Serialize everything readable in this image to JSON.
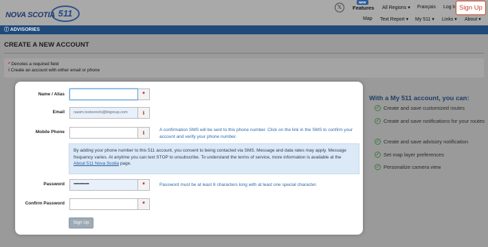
{
  "header": {
    "logo_text": "NOVA SCOTIA",
    "logo_badge": "511",
    "x_icon": "x-social-icon",
    "new_badge": "NEW",
    "features": "Features",
    "top_nav": [
      "All Regions ▾",
      "Français",
      "Log In"
    ],
    "signup_label": "Sign Up",
    "sub_nav": [
      "Map",
      "Text Report ▾",
      "My 511 ▾",
      "Links ▾",
      "About ▾"
    ]
  },
  "advisories": {
    "icon": "info-circle-icon",
    "label": "ADVISORIES"
  },
  "page": {
    "title": "CREATE A NEW ACCOUNT",
    "note_required": "Denotes a required field",
    "note_required_mark": "*",
    "note_info": "Create an account with either email or phone",
    "note_info_mark": "i"
  },
  "form": {
    "name_label": "Name / Alias",
    "name_value": "",
    "email_label": "Email",
    "email_value": "nasim.tootoonchi@ibigroup.com",
    "mobile_label": "Mobile Phone",
    "mobile_value": "",
    "mobile_hint": "A confirmation SMS will be sent to this phone number. Click on the link in the SMS to confirm your account and verify your phone number.",
    "consent_text": "By adding your phone number to this 511 account, you consent to being contacted via SMS. Message and data rates may apply. Message frequency varies. At anytime you can text STOP to unsubscribe. To understand the terms of service, more information is available at the",
    "consent_link": "About 511 Nova Scotia",
    "consent_tail": " page.",
    "password_label": "Password",
    "password_value": "••••••••••••••",
    "password_hint": "Password must be at least 8 characters long with at least one special character.",
    "confirm_label": "Confirm Password",
    "confirm_value": "",
    "required_mark": "*",
    "info_mark": "i",
    "submit_label": "Sign Up"
  },
  "benefits": {
    "title": "With a My 511 account, you can:",
    "items": [
      "Create and save customized routes",
      "Create and save notifications for your routes",
      "Create and save advisory notification",
      "Set map layer preferences",
      "Personalize camera view"
    ],
    "check_icon": "check-circle-icon",
    "check_glyph": "✓"
  },
  "colors": {
    "accent": "#1f4a7a",
    "signup": "#c8412a",
    "required": "#c0141b",
    "hint": "#2a6aa8"
  }
}
